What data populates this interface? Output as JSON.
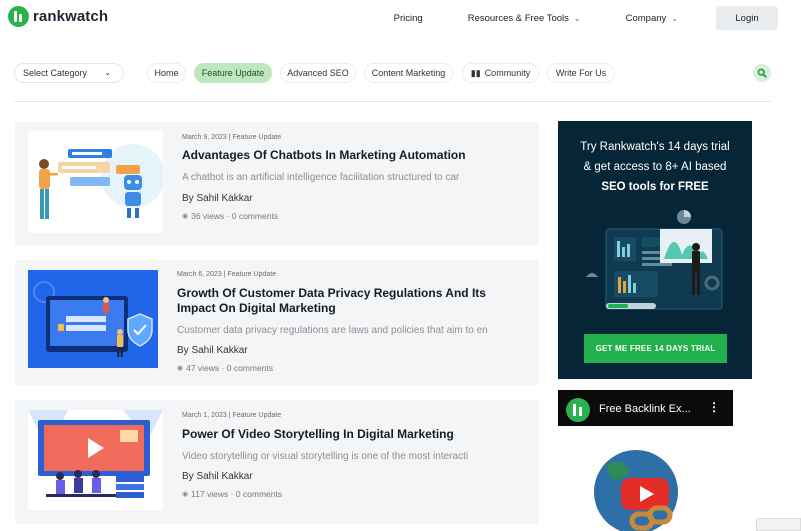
{
  "header": {
    "logo_text": "rankwatch",
    "nav": [
      {
        "label": "Pricing",
        "has_dropdown": false
      },
      {
        "label": "Resources & Free Tools",
        "has_dropdown": true
      },
      {
        "label": "Company",
        "has_dropdown": true
      }
    ],
    "login_label": "Login"
  },
  "category_bar": {
    "select_label": "Select Category",
    "pills": [
      {
        "label": "Home",
        "active": false
      },
      {
        "label": "Feature Update",
        "active": true
      },
      {
        "label": "Advanced SEO",
        "active": false
      },
      {
        "label": "Content Marketing",
        "active": false
      },
      {
        "label": "Community",
        "active": false,
        "icon": "community-icon"
      },
      {
        "label": "Write For Us",
        "active": false
      }
    ]
  },
  "articles": [
    {
      "meta": "March 9, 2023 | Feature Update",
      "title": "Advantages Of Chatbots In Marketing Automation",
      "excerpt": "A chatbot is an artificial intelligence facilitation structured to car",
      "author": "By Sahil Kakkar",
      "stats": "36 views · 0 comments"
    },
    {
      "meta": "March 6, 2023 | Feature Update",
      "title": "Growth Of Customer Data Privacy Regulations And Its Impact On Digital Marketing",
      "excerpt": "Customer data privacy regulations are laws and policies that aim to en",
      "author": "By Sahil Kakkar",
      "stats": "47 views · 0 comments"
    },
    {
      "meta": "March 1, 2023 | Feature Update",
      "title": "Power Of Video Storytelling In Digital Marketing",
      "excerpt": "Video storytelling or visual storytelling is one of the most interacti",
      "author": "By Sahil Kakkar",
      "stats": "117 views · 0 comments"
    }
  ],
  "sidebar": {
    "promo_line1": "Try Rankwatch's 14 days trial",
    "promo_line2": "& get access to 8+ AI based",
    "promo_line3": "SEO tools for FREE",
    "promo_cta": "GET ME FREE 14 DAYS TRIAL",
    "video_title": "Free Backlink Ex...",
    "video_more_icon": "⋮"
  },
  "colors": {
    "brand_green": "#2bb24c",
    "active_pill": "#bde8bf",
    "promo_bg": "#062637",
    "cta_green": "#21b04b"
  }
}
